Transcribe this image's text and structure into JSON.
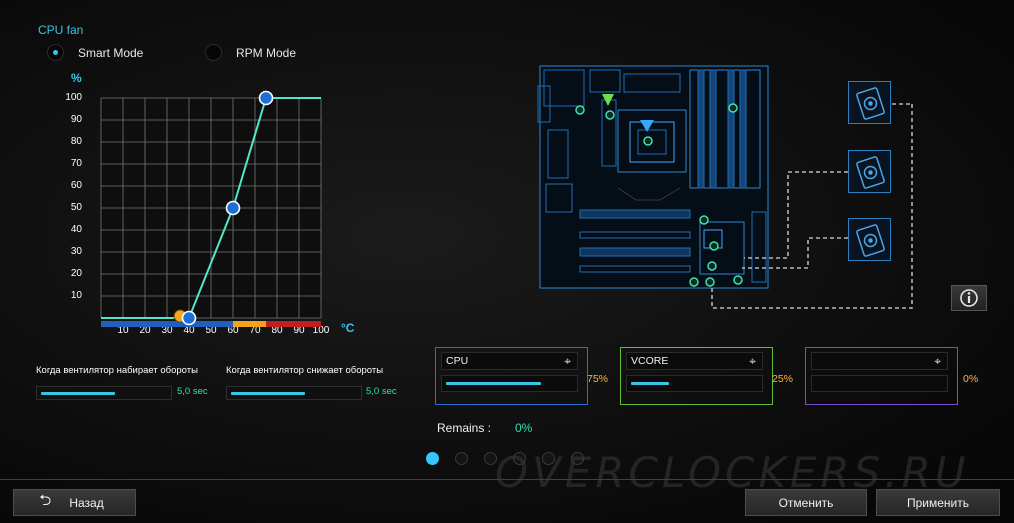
{
  "fan": {
    "title": "CPU fan",
    "smart_mode_label": "Smart Mode",
    "rpm_mode_label": "RPM Mode",
    "selected_mode": "smart"
  },
  "chart_data": {
    "type": "line",
    "ylabel": "%",
    "xlabel": "°C",
    "xlim": [
      0,
      100
    ],
    "ylim": [
      0,
      100
    ],
    "xticks": [
      10,
      20,
      30,
      40,
      50,
      60,
      70,
      80,
      90,
      100
    ],
    "yticks": [
      10,
      20,
      30,
      40,
      50,
      60,
      70,
      80,
      90,
      100
    ],
    "grid": true,
    "line_color": "#4ee8c8",
    "series": [
      {
        "x": [
          0,
          40,
          60,
          75,
          100
        ],
        "y": [
          0,
          0,
          50,
          100,
          100
        ]
      }
    ],
    "control_points": [
      {
        "x": 40,
        "y": 0
      },
      {
        "x": 60,
        "y": 50
      },
      {
        "x": 75,
        "y": 100
      }
    ],
    "marker": {
      "x": 36,
      "y": 0,
      "color": "#f5a623"
    },
    "temperature_bands": [
      {
        "from": 0,
        "to": 60,
        "color": "#1f5fc0"
      },
      {
        "from": 60,
        "to": 75,
        "color": "#f2a21e"
      },
      {
        "from": 75,
        "to": 100,
        "color": "#c01f1f"
      }
    ]
  },
  "ramp": {
    "up_label": "Когда вентилятор набирает обороты",
    "up_value": "5,0 sec",
    "down_label": "Когда вентилятор снижает обороты",
    "down_value": "5,0 sec",
    "fill_fraction": 0.58
  },
  "sensors": [
    {
      "name": "CPU",
      "percent": "75%",
      "fill_fraction": 0.75,
      "color": "#2a6fd8"
    },
    {
      "name": "VCORE",
      "percent": "25%",
      "fill_fraction": 0.3,
      "color": "#5fbf3c"
    },
    {
      "name": "",
      "percent": "0%",
      "fill_fraction": 0,
      "color": "#7b4fc8"
    }
  ],
  "remains": {
    "label": "Remains :",
    "value": "0%"
  },
  "pager": {
    "count": 6,
    "active": 0
  },
  "buttons": {
    "back": "Назад",
    "cancel": "Отменить",
    "apply": "Применить"
  },
  "info_icon": "info-icon",
  "watermark": "OVERCLOCKERS.RU",
  "colors": {
    "accent": "#38c6e8",
    "curve": "#4ee8c8",
    "percent": "#ffb43c",
    "time": "#2ee0b0"
  }
}
